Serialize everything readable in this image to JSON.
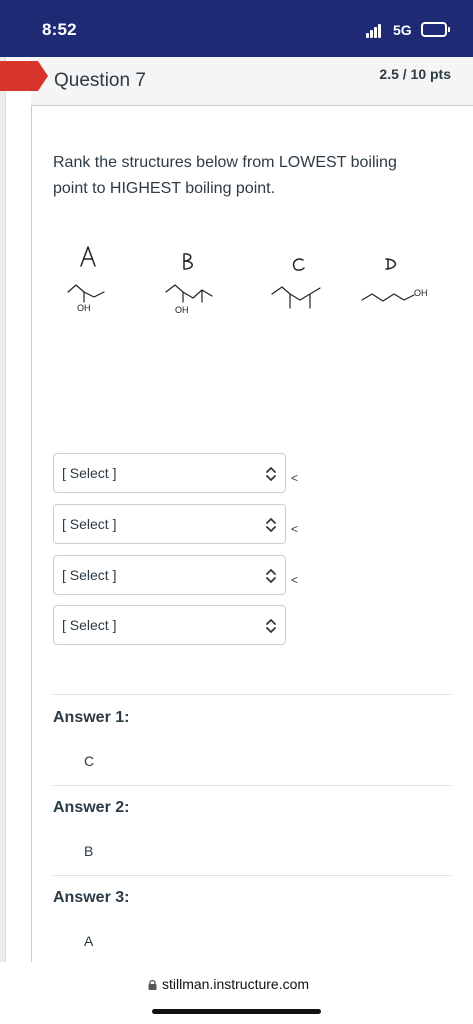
{
  "status_bar": {
    "time": "8:52",
    "network": "5G",
    "icons": [
      "signal-icon",
      "battery-icon"
    ]
  },
  "question": {
    "title": "Question 7",
    "points": "2.5 / 10 pts",
    "prompt": "Rank the structures below from LOWEST boiling point to HIGHEST boiling point."
  },
  "structures": {
    "labels": [
      "A",
      "B",
      "C",
      "D"
    ],
    "oh_labels": [
      "OH",
      "OH",
      "OH"
    ]
  },
  "selects": {
    "placeholder": "[ Select ]",
    "separator": "<",
    "values": [
      "[ Select ]",
      "[ Select ]",
      "[ Select ]",
      "[ Select ]"
    ]
  },
  "answers": [
    {
      "label": "Answer 1:",
      "value": "C"
    },
    {
      "label": "Answer 2:",
      "value": "B"
    },
    {
      "label": "Answer 3:",
      "value": "A"
    }
  ],
  "browser": {
    "url": "stillman.instructure.com",
    "icons": [
      "lock-icon"
    ]
  },
  "colors": {
    "status_bar": "#1f2a74",
    "flag": "#d9342b",
    "text": "#2d3b45"
  }
}
